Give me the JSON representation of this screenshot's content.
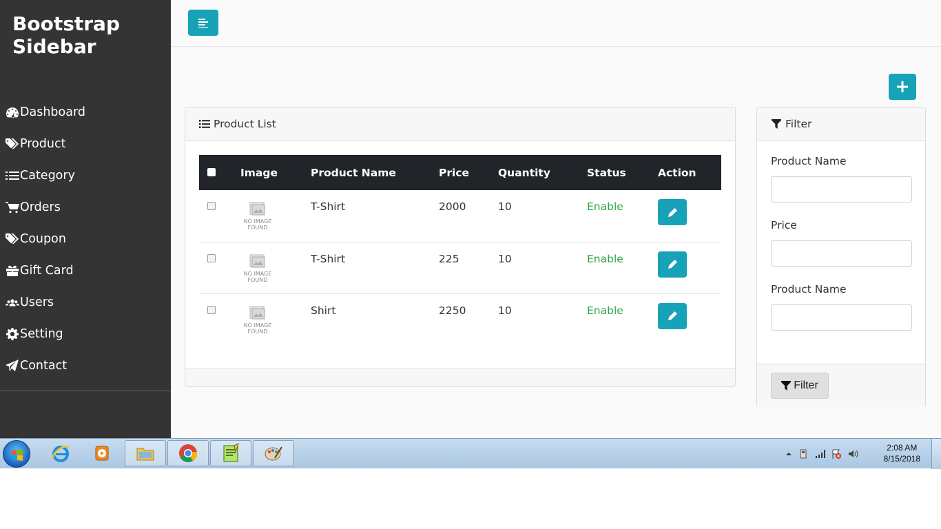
{
  "sidebar": {
    "brand": "Bootstrap Sidebar",
    "items": [
      {
        "label": "Dashboard",
        "icon": "dashboard-icon"
      },
      {
        "label": "Product",
        "icon": "tags-icon"
      },
      {
        "label": "Category",
        "icon": "list-icon"
      },
      {
        "label": "Orders",
        "icon": "cart-icon"
      },
      {
        "label": "Coupon",
        "icon": "tags-icon"
      },
      {
        "label": "Gift Card",
        "icon": "gift-icon"
      },
      {
        "label": "Users",
        "icon": "users-icon"
      },
      {
        "label": "Setting",
        "icon": "gear-icon"
      },
      {
        "label": "Contact",
        "icon": "paper-plane-icon"
      }
    ]
  },
  "product_list": {
    "title": "Product List",
    "columns": [
      "Image",
      "Product Name",
      "Price",
      "Quantity",
      "Status",
      "Action"
    ],
    "no_image_text": [
      "NO IMAGE",
      "FOUND"
    ],
    "rows": [
      {
        "name": "T-Shirt",
        "price": "2000",
        "quantity": "10",
        "status": "Enable"
      },
      {
        "name": "T-Shirt",
        "price": "225",
        "quantity": "10",
        "status": "Enable"
      },
      {
        "name": "Shirt",
        "price": "2250",
        "quantity": "10",
        "status": "Enable"
      }
    ]
  },
  "filter": {
    "title": "Filter",
    "fields": [
      {
        "label": "Product Name",
        "value": ""
      },
      {
        "label": "Price",
        "value": ""
      },
      {
        "label": "Product Name",
        "value": ""
      }
    ],
    "button_label": "Filter"
  },
  "taskbar": {
    "time": "2:08 AM",
    "date": "8/15/2018"
  },
  "colors": {
    "sidebar_bg": "#343434",
    "accent": "#17a2b8",
    "status_enable": "#28a745",
    "table_head": "#212529"
  }
}
